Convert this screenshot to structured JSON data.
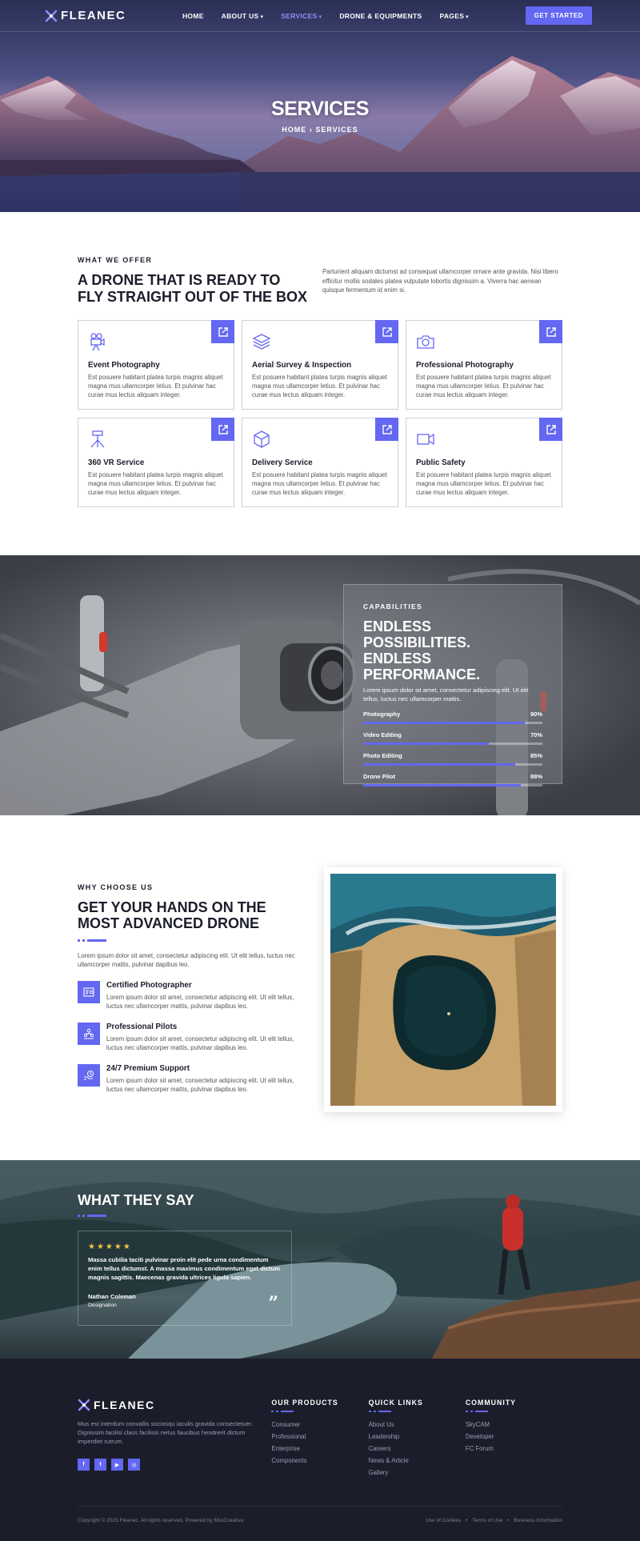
{
  "nav": {
    "brand": "FLEANEC",
    "items": [
      {
        "label": "HOME",
        "dropdown": false,
        "active": false
      },
      {
        "label": "ABOUT US",
        "dropdown": true,
        "active": false
      },
      {
        "label": "SERVICES",
        "dropdown": true,
        "active": true
      },
      {
        "label": "DRONE & EQUIPMENTS",
        "dropdown": false,
        "active": false
      },
      {
        "label": "PAGES",
        "dropdown": true,
        "active": false
      }
    ],
    "cta": "GET STARTED"
  },
  "hero": {
    "title": "SERVICES",
    "breadcrumb_home": "HOME",
    "breadcrumb_sep": "›",
    "breadcrumb_current": "SERVICES"
  },
  "services": {
    "eyebrow": "WHAT WE OFFER",
    "heading": "A DRONE THAT IS READY TO FLY STRAIGHT OUT OF THE BOX",
    "description": "Parturient aliquam dictumst ad consequat ullamcorper ornare ante gravida. Nisi libero efficitur mollis sodales platea vulputate lobortis dignissim a. Viverra hac aenean quisque fermentum id enim si.",
    "cards": [
      {
        "icon": "video-camera-icon",
        "title": "Event Photography",
        "text": "Est posuere habitant platea turpis magnis aliquet magna mus ullamcorper letius. Et pulvinar hac curae mus lectus aliquam integer."
      },
      {
        "icon": "layers-icon",
        "title": "Aerial Survey & Inspection",
        "text": "Est posuere habitant platea turpis magnis aliquet magna mus ullamcorper letius. Et pulvinar hac curae mus lectus aliquam integer."
      },
      {
        "icon": "camera-icon",
        "title": "Professional Photography",
        "text": "Est posuere habitant platea turpis magnis aliquet magna mus ullamcorper letius. Et pulvinar hac curae mus lectus aliquam integer."
      },
      {
        "icon": "tripod-icon",
        "title": "360 VR Service",
        "text": "Est posuere habitant platea turpis magnis aliquet magna mus ullamcorper letius. Et pulvinar hac curae mus lectus aliquam integer."
      },
      {
        "icon": "box-icon",
        "title": "Delivery Service",
        "text": "Est posuere habitant platea turpis magnis aliquet magna mus ullamcorper letius. Et pulvinar hac curae mus lectus aliquam integer."
      },
      {
        "icon": "video-icon",
        "title": "Public Safety",
        "text": "Est posuere habitant platea turpis magnis aliquet magna mus ullamcorper letius. Et pulvinar hac curae mus lectus aliquam integer."
      }
    ]
  },
  "capabilities": {
    "eyebrow": "CAPABILITIES",
    "heading": "ENDLESS POSSIBILITIES. ENDLESS PERFORMANCE.",
    "description": "Lorem ipsum dolor sit amet, consectetur adipiscing elit. Ut elit tellus, luctus nec ullamcorper mattis.",
    "skills": [
      {
        "name": "Photography",
        "value_label": "90%",
        "value": 90
      },
      {
        "name": "Video Editing",
        "value_label": "70%",
        "value": 70
      },
      {
        "name": "Photo Editing",
        "value_label": "85%",
        "value": 85
      },
      {
        "name": "Drone Pilot",
        "value_label": "88%",
        "value": 88
      }
    ]
  },
  "why": {
    "eyebrow": "WHY CHOOSE US",
    "heading": "GET YOUR HANDS ON THE MOST ADVANCED DRONE",
    "lead": "Lorem ipsum dolor sit amet, consectetur adipiscing elit. Ut elit tellus, luctus nec ullamcorper mattis, pulvinar dapibus leo.",
    "features": [
      {
        "icon": "certificate-icon",
        "title": "Certified Photographer",
        "text": "Lorem ipsum dolor sit amet, consectetur adipiscing elit. Ut elit tellus, luctus nec ullamcorper mattis, pulvinar dapibus leo."
      },
      {
        "icon": "team-icon",
        "title": "Professional Pilots",
        "text": "Lorem ipsum dolor sit amet, consectetur adipiscing elit. Ut elit tellus, luctus nec ullamcorper mattis, pulvinar dapibus leo."
      },
      {
        "icon": "support-icon",
        "title": "24/7 Premium Support",
        "text": "Lorem ipsum dolor sit amet, consectetur adipiscing elit. Ut elit tellus, luctus nec ullamcorper mattis, pulvinar dapibus leo."
      }
    ]
  },
  "testimonial": {
    "heading": "WHAT THEY SAY",
    "stars": "★★★★★",
    "quote": "Massa cubilia taciti pulvinar proin elit pede urna condimentum enim tellus dictumst. A massa maximus condimentum eget dictum magnis sagittis. Maecenas gravida ultrices ligula sapien.",
    "name": "Nathan Coleman",
    "role": "Designation",
    "quote_mark": "”"
  },
  "footer": {
    "brand": "FLEANEC",
    "about": "Mus est interdum convallis sociosqu iaculis gravida consectetuer. Dignissim facilisi class facilisis netus faucibus hendrerit dictum imperdiet rutrum.",
    "socials": [
      "f",
      "t",
      "▶",
      "◎"
    ],
    "columns": [
      {
        "title": "OUR PRODUCTS",
        "links": [
          "Consumer",
          "Professional",
          "Enterprise",
          "Components"
        ]
      },
      {
        "title": "QUICK LINKS",
        "links": [
          "About Us",
          "Leadership",
          "Careers",
          "News & Article",
          "Gallery"
        ]
      },
      {
        "title": "COMMUNITY",
        "links": [
          "SkyCAM",
          "Developer",
          "FC Forum"
        ]
      }
    ],
    "copyright": "Copyright © 2023 Fleanec. All rights reserved. Powered by MoxCreative.",
    "legal": [
      "Use of Cookies",
      "•",
      "Terms of Use",
      "•",
      "Business Information"
    ]
  }
}
